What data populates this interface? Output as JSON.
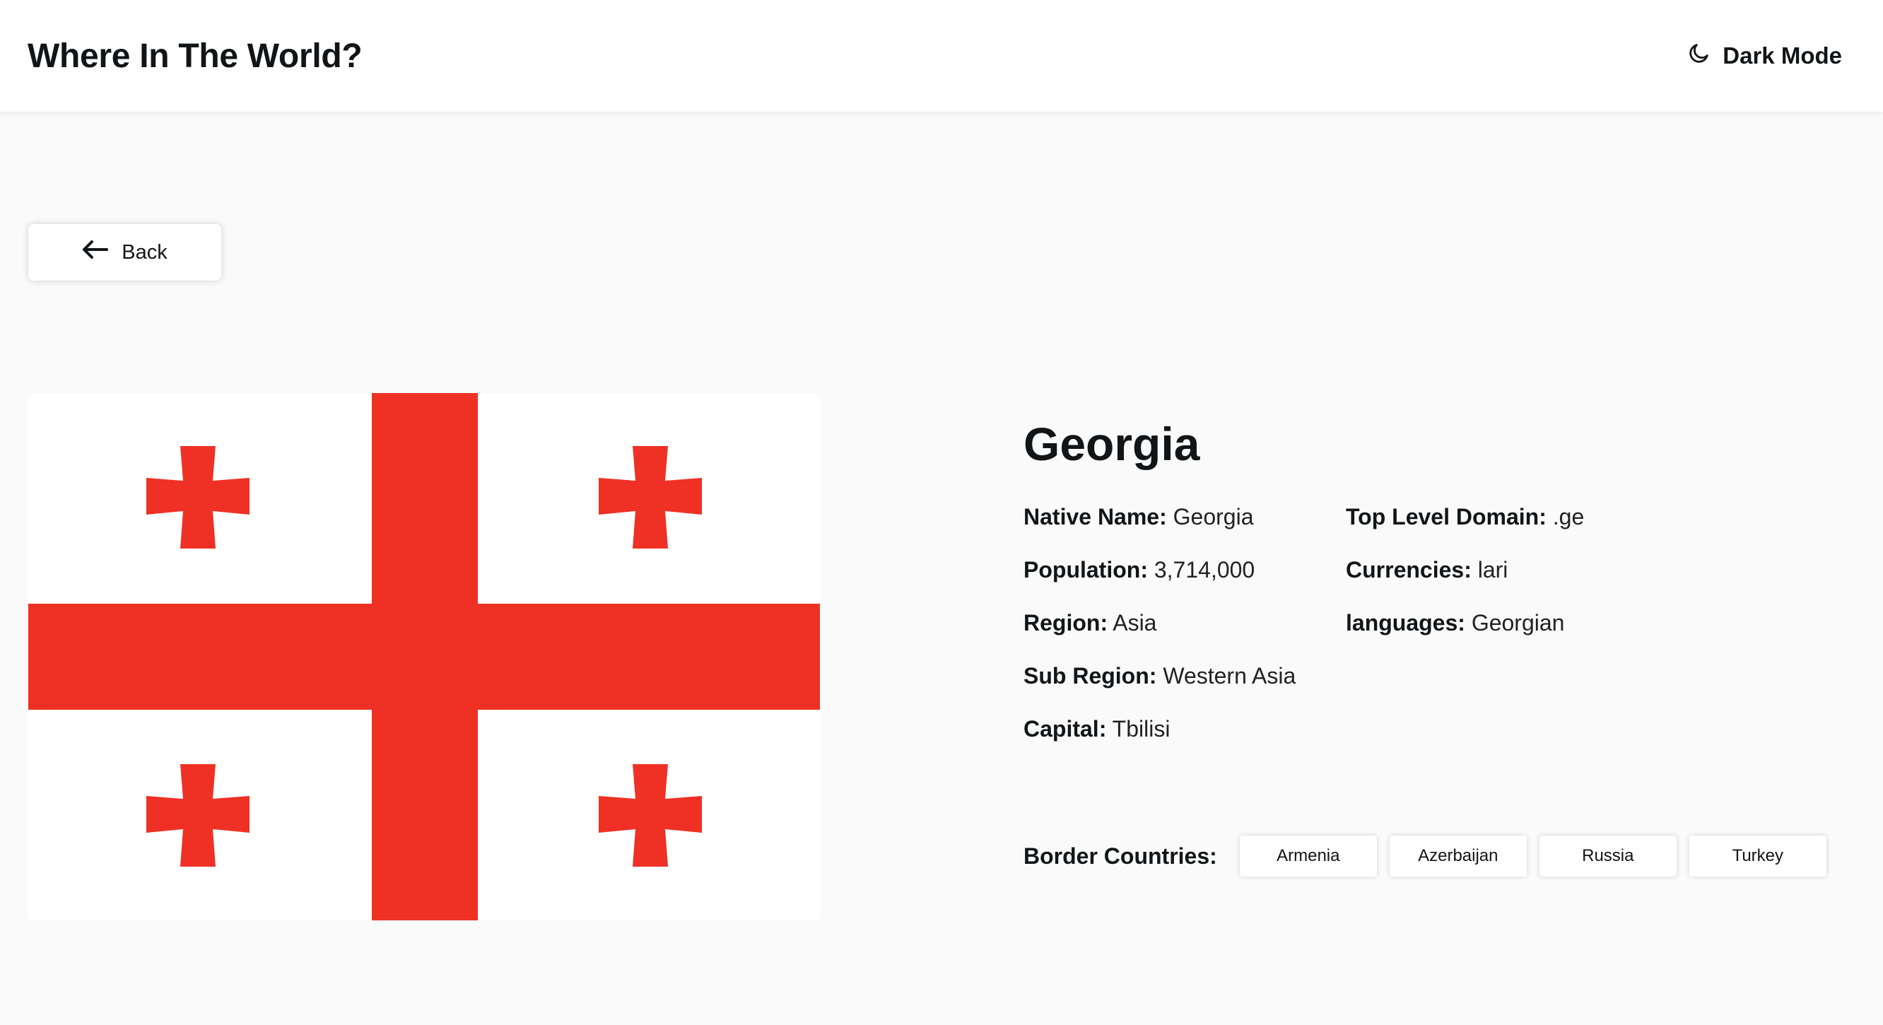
{
  "header": {
    "title": "Where In The World?",
    "dark_mode_label": "Dark Mode"
  },
  "back_button": {
    "label": "Back"
  },
  "country": {
    "name": "Georgia",
    "left_info": [
      {
        "label": "Native Name:",
        "value": "Georgia"
      },
      {
        "label": "Population:",
        "value": "3,714,000"
      },
      {
        "label": "Region:",
        "value": "Asia"
      },
      {
        "label": "Sub Region:",
        "value": "Western Asia"
      },
      {
        "label": "Capital:",
        "value": "Tbilisi"
      }
    ],
    "right_info": [
      {
        "label": "Top Level Domain:",
        "value": ".ge"
      },
      {
        "label": "Currencies:",
        "value": "lari"
      },
      {
        "label": "languages:",
        "value": "Georgian"
      }
    ],
    "border_label": "Border Countries:",
    "borders": [
      "Armenia",
      "Azerbaijan",
      "Russia",
      "Turkey"
    ]
  },
  "colors": {
    "flag_red": "#ee3124",
    "background": "#fafafa",
    "header_bg": "#ffffff",
    "text": "#111517"
  },
  "icons": {
    "theme_toggle": "moon-icon",
    "back": "arrow-left-icon"
  }
}
